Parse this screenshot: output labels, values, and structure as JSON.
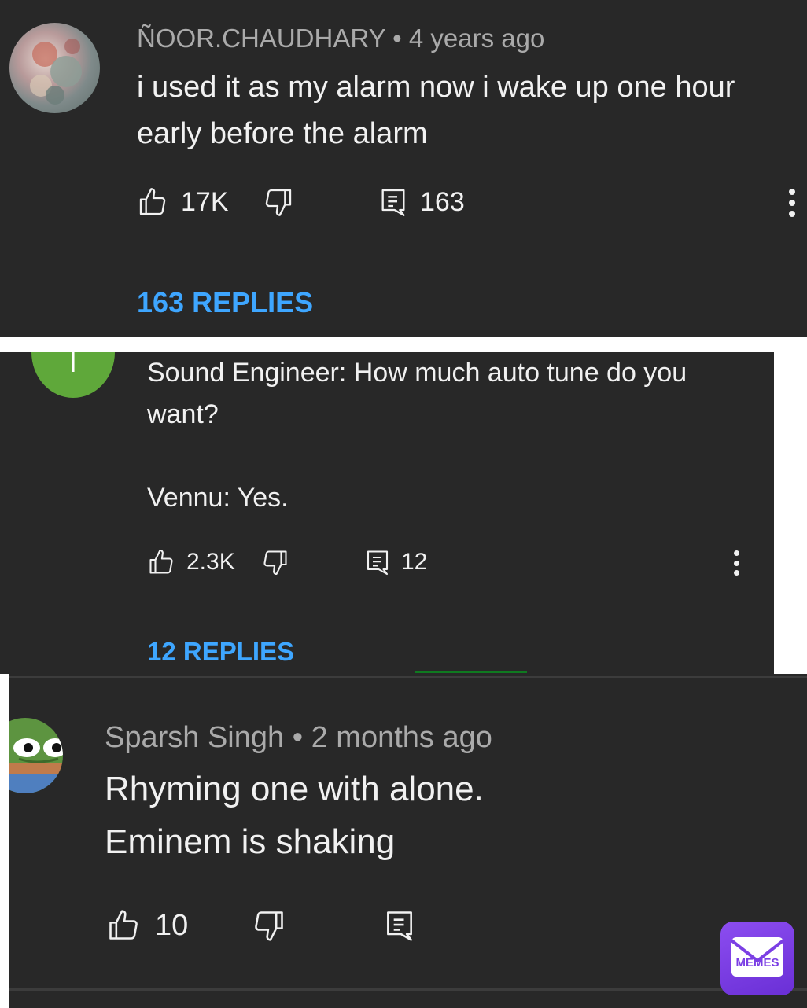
{
  "comments": [
    {
      "author": "ÑOOR.CHAUDHARY",
      "age": "4 years ago",
      "lines": [
        "i used it as my alarm now i wake up one hour",
        "early before the alarm"
      ],
      "likes": "17K",
      "reply_count": "163",
      "replies_label": "163 REPLIES"
    },
    {
      "avatar_letter": "l",
      "lines": [
        "Sound Engineer: How much auto tune do you",
        "want?",
        "",
        "Vennu: Yes."
      ],
      "likes": "2.3K",
      "reply_count": "12",
      "replies_label": "12 REPLIES"
    },
    {
      "author": "Sparsh Singh",
      "age": "2 months ago",
      "lines": [
        "Rhyming one with alone.",
        "Eminem is shaking"
      ],
      "likes": "10"
    }
  ],
  "watermark": "MEMES",
  "colors": {
    "panel_bg": "#282828",
    "text": "#f1f1f1",
    "meta": "#aaaaaa",
    "replies_link": "#3ea6ff",
    "avatar_green": "#5fa83a",
    "watermark_purple": "#7b3fe4"
  }
}
